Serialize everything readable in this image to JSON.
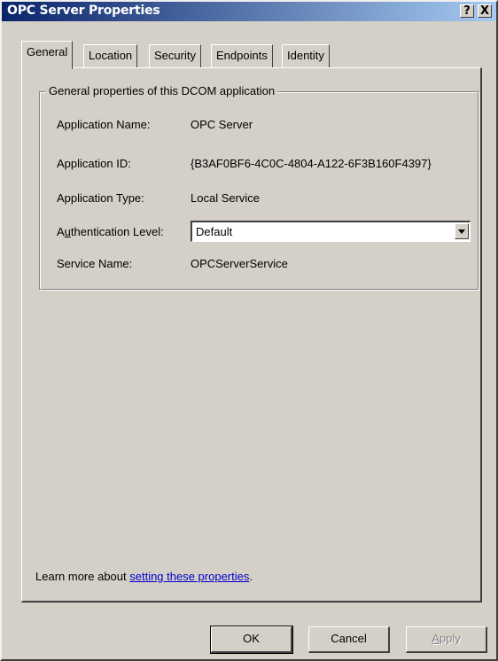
{
  "window": {
    "title": "OPC Server Properties",
    "help_label": "?",
    "close_label": "X"
  },
  "tabs": [
    {
      "label": "General",
      "active": true
    },
    {
      "label": "Location",
      "active": false
    },
    {
      "label": "Security",
      "active": false
    },
    {
      "label": "Endpoints",
      "active": false
    },
    {
      "label": "Identity",
      "active": false
    }
  ],
  "group": {
    "title": "General properties of this DCOM application",
    "fields": [
      {
        "label": "Application Name:",
        "value": "OPC Server"
      },
      {
        "label": "Application ID:",
        "value": "{B3AF0BF6-4C0C-4804-A122-6F3B160F4397}"
      },
      {
        "label": "Application Type:",
        "value": "Local Service"
      },
      {
        "label_pre": "A",
        "label_u": "u",
        "label_post": "thentication Level:",
        "value": "Default"
      },
      {
        "label": "Service Name:",
        "value": "OPCServerService"
      }
    ]
  },
  "footer": {
    "learn_prefix": "Learn more about ",
    "learn_link": "setting these properties",
    "learn_suffix": "."
  },
  "buttons": {
    "ok": "OK",
    "cancel": "Cancel",
    "apply_u": "A",
    "apply_rest": "pply"
  }
}
